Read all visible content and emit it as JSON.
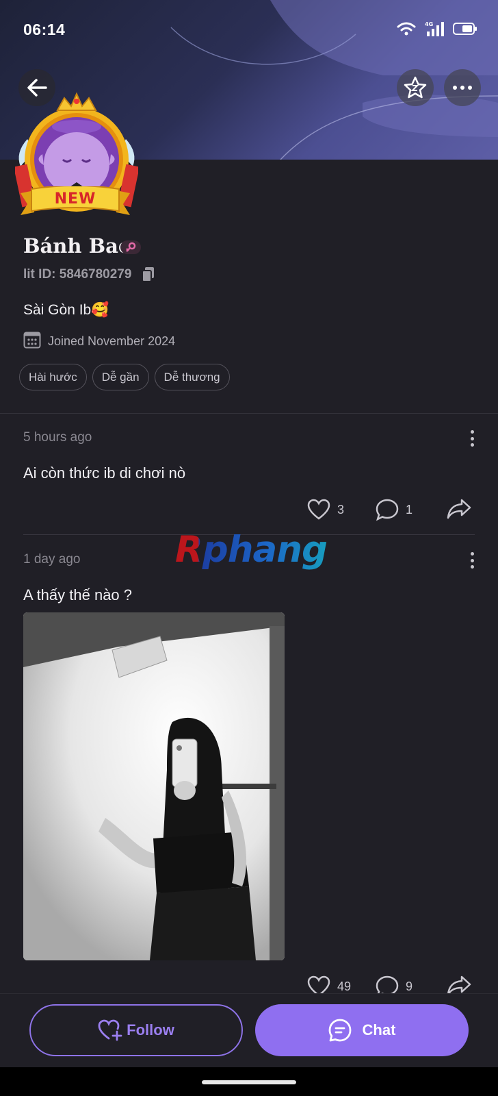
{
  "status_bar": {
    "time": "06:14",
    "network": "4G"
  },
  "header": {
    "back_icon": "arrow-left-icon",
    "star_icon": "star-z-icon",
    "more_icon": "ellipsis-icon"
  },
  "avatar": {
    "badge_text": "NEW"
  },
  "profile": {
    "name": "Bánh Bao",
    "lit_id": "lit ID: 5846780279",
    "bio": "Sài Gòn Ib🥰",
    "joined": "Joined November 2024",
    "tags": [
      "Hài hước",
      "Dễ gần",
      "Dễ thương"
    ]
  },
  "posts": [
    {
      "time": "5 hours ago",
      "text": "Ai còn thức ib di chơi nò",
      "likes": "3",
      "comments": "1"
    },
    {
      "time": "1 day ago",
      "text": "A thấy thế nào ?",
      "likes": "49",
      "comments": "9"
    }
  ],
  "watermark": "Rphang",
  "actions": {
    "follow_label": "Follow",
    "chat_label": "Chat"
  },
  "colors": {
    "accent": "#8f6ff0",
    "background": "#201f26"
  }
}
